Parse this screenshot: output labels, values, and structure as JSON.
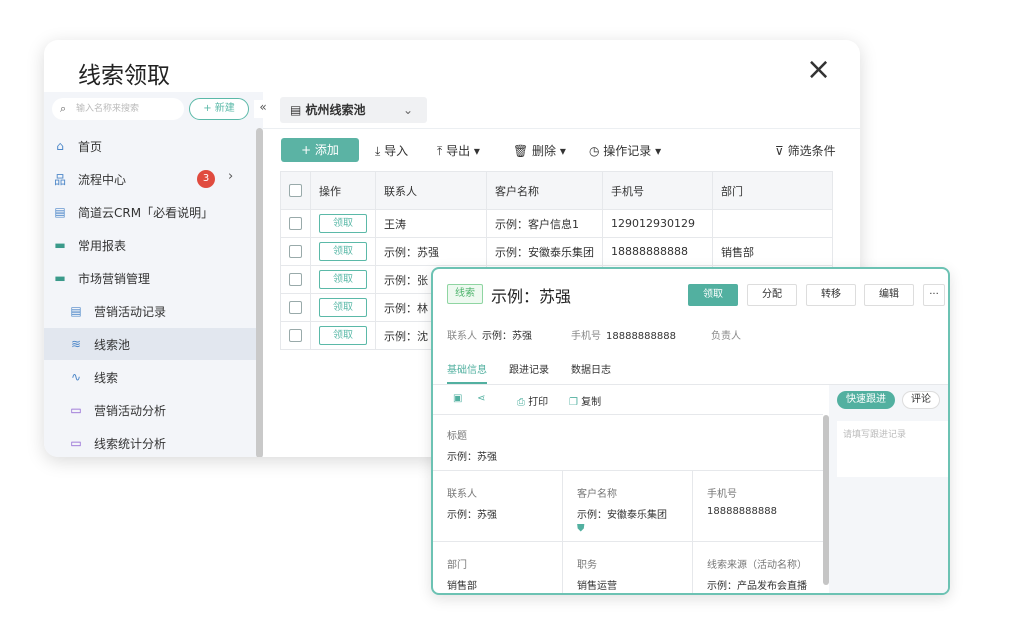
{
  "window": {
    "title": "线索领取",
    "close_icon": "×"
  },
  "sidebar": {
    "search_placeholder": "输入名称来搜索",
    "new_label": "+ 新建",
    "collapse": "«",
    "items": [
      {
        "label": "首页",
        "icon": "⌂"
      },
      {
        "label": "流程中心",
        "icon": "品",
        "badge": "3"
      },
      {
        "label": "简道云CRM「必看说明」",
        "icon": "▤"
      },
      {
        "label": "常用报表",
        "icon": "▬"
      },
      {
        "label": "市场营销管理",
        "icon": "▬"
      },
      {
        "label": "营销活动记录",
        "icon": "▤"
      },
      {
        "label": "线索池",
        "icon": "≋"
      },
      {
        "label": "线索",
        "icon": "∿"
      },
      {
        "label": "营销活动分析",
        "icon": "▭"
      },
      {
        "label": "线索统计分析",
        "icon": "▭"
      }
    ]
  },
  "main": {
    "pool": "杭州线索池",
    "toolbar": {
      "add": "+ 添加",
      "import": "⤓ 导入",
      "export": "⤒ 导出 ▾",
      "delete": "🗑 删除 ▾",
      "log": "◷ 操作记录 ▾",
      "filter": "⊽ 筛选条件"
    },
    "columns": [
      "操作",
      "联系人",
      "客户名称",
      "手机号",
      "部门"
    ],
    "claim_label": "领取",
    "rows": [
      {
        "contact": "王涛",
        "customer": "示例：客户信息1",
        "phone": "129012930129",
        "dept": ""
      },
      {
        "contact": "示例：苏强",
        "customer": "示例：安徽泰乐集团",
        "phone": "18888888888",
        "dept": "销售部"
      },
      {
        "contact": "示例：张",
        "customer": "",
        "phone": "",
        "dept": ""
      },
      {
        "contact": "示例：林",
        "customer": "",
        "phone": "",
        "dept": ""
      },
      {
        "contact": "示例：沈",
        "customer": "",
        "phone": "",
        "dept": ""
      }
    ]
  },
  "detail": {
    "tag": "线索",
    "title": "示例：苏强",
    "buttons": {
      "claim": "领取",
      "assign": "分配",
      "transfer": "转移",
      "edit": "编辑",
      "more": "···"
    },
    "meta": {
      "contact_label": "联系人",
      "contact": "示例：苏强",
      "phone_label": "手机号",
      "phone": "18888888888",
      "owner_label": "负责人"
    },
    "tabs": [
      "基础信息",
      "跟进记录",
      "数据日志"
    ],
    "tools": {
      "print": "打印",
      "copy": "复制"
    },
    "fields": {
      "title_label": "标题",
      "title": "示例：苏强",
      "contact_label": "联系人",
      "contact": "示例：苏强",
      "customer_label": "客户名称",
      "customer": "示例：安徽泰乐集团",
      "phone_label": "手机号",
      "phone": "18888888888",
      "dept_label": "部门",
      "dept": "销售部",
      "position_label": "职务",
      "position": "销售运营",
      "source_label": "线索来源（活动名称）",
      "source": "示例：产品发布会直播"
    },
    "side": {
      "quick": "快速跟进",
      "comment": "评论",
      "placeholder": "请填写跟进记录"
    }
  }
}
